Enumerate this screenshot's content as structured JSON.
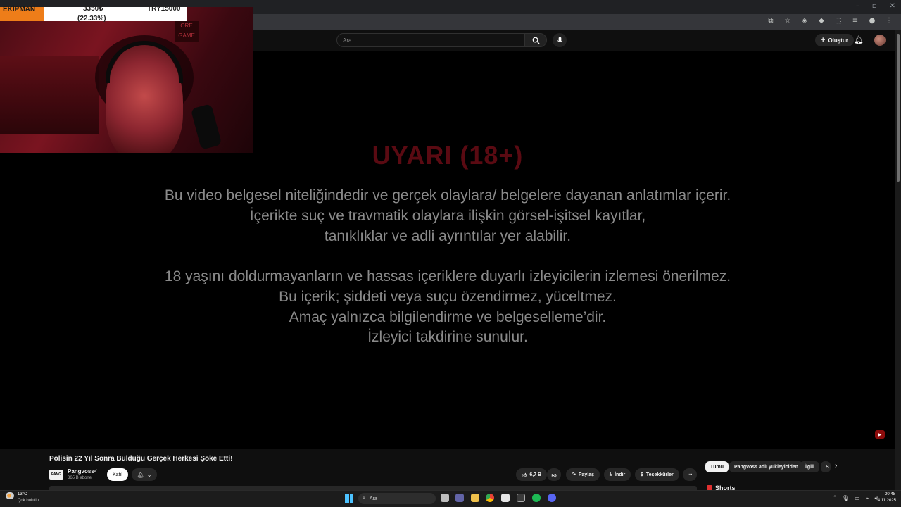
{
  "youtube": {
    "search_placeholder": "Ara",
    "create_label": "Oluştur"
  },
  "video": {
    "warning_title": "UYARI (18+)",
    "warning_lines": [
      "Bu video belgesel niteliğindedir ve gerçek olaylara/ belgelere dayanan anlatımlar içerir.",
      "İçerikte suç ve travmatik olaylara ilişkin görsel-işitsel kayıtlar,",
      "tanıklıklar ve adli ayrıntılar yer alabilir.",
      "18 yaşını doldurmayanların ve hassas içeriklere duyarlı izleyicilerin izlemesi önerilmez.",
      "Bu içerik; şiddeti veya suçu özendirmez, yüceltmez.",
      "Amaç yalnızca bilgilendirme ve belgeselleme’dir.",
      "İzleyici takdirine sunulur."
    ],
    "title": "Polisin 22 Yıl Sonra Bulduğu Gerçek Herkesi Şoke Etti!",
    "channel_logo_text": "PANG",
    "channel_name": "Pangvoss",
    "subscribers": "365 B abone",
    "join_label": "Katıl",
    "like_count": "6,7 B",
    "share_label": "Paylaş",
    "download_label": "İndir",
    "thanks_label": "Teşekkürler"
  },
  "chips": [
    "Tümü",
    "Pangvoss adlı yükleyiciden",
    "İlgili",
    "S"
  ],
  "shorts_label": "Shorts",
  "overlay": {
    "donation_label": "EKİPMAN",
    "donation_current": "3350₺",
    "donation_percent": "(22.33%)",
    "donation_goal": "TRY15000",
    "cam_sign_text": "ORE GAME"
  },
  "taskbar": {
    "weather_temp": "13°C",
    "weather_desc": "Çok bulutlu",
    "search_label": "Ara",
    "time": "20:48",
    "date": "4.11.2025"
  },
  "colors": {
    "warning_red": "#5a0a12",
    "donation_orange": "#ee7d19",
    "youtube_red": "#8b0b0b"
  }
}
